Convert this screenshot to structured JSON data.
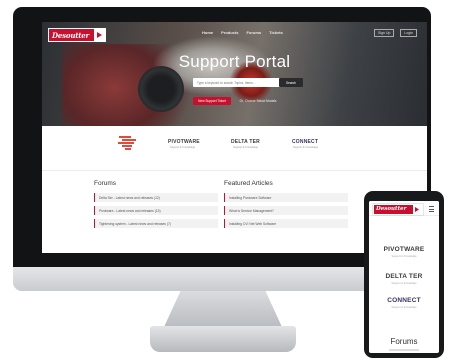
{
  "brand": {
    "logo_text": "Desoutter",
    "accent": "#c8102e"
  },
  "nav": {
    "items": [
      "Home",
      "Products",
      "Forums",
      "Tickets"
    ],
    "right": [
      "Sign Up",
      "Login"
    ]
  },
  "hero": {
    "title": "Support Portal",
    "search_placeholder": "Type a keyword to search Topics, Items...",
    "search_button": "Search",
    "primary_button": "New Support Ticket",
    "secondary_link": "Or, Choose Below Modals"
  },
  "products": [
    {
      "name": "PIVOTWARE",
      "sub": "Support & Knowledge"
    },
    {
      "name": "DELTA TER",
      "sub": "Support & Knowledge"
    },
    {
      "name": "CONNECT",
      "sub": "Support & Knowledge"
    }
  ],
  "forums": {
    "title": "Forums",
    "items": [
      "Delta Ser - Latest news and releases (12)",
      "Pivotware - Latest news and releases (15)",
      "Tightening system - Latest news and releases (7)"
    ]
  },
  "featured": {
    "title": "Featured Articles",
    "items": [
      "Installing Pivotware Software",
      "What is Service Management?",
      "Installing CVI Net Web Software"
    ]
  },
  "phone": {
    "products": [
      "PIVOTWARE",
      "DELTA TER",
      "CONNECT"
    ],
    "forums_title": "Forums"
  }
}
